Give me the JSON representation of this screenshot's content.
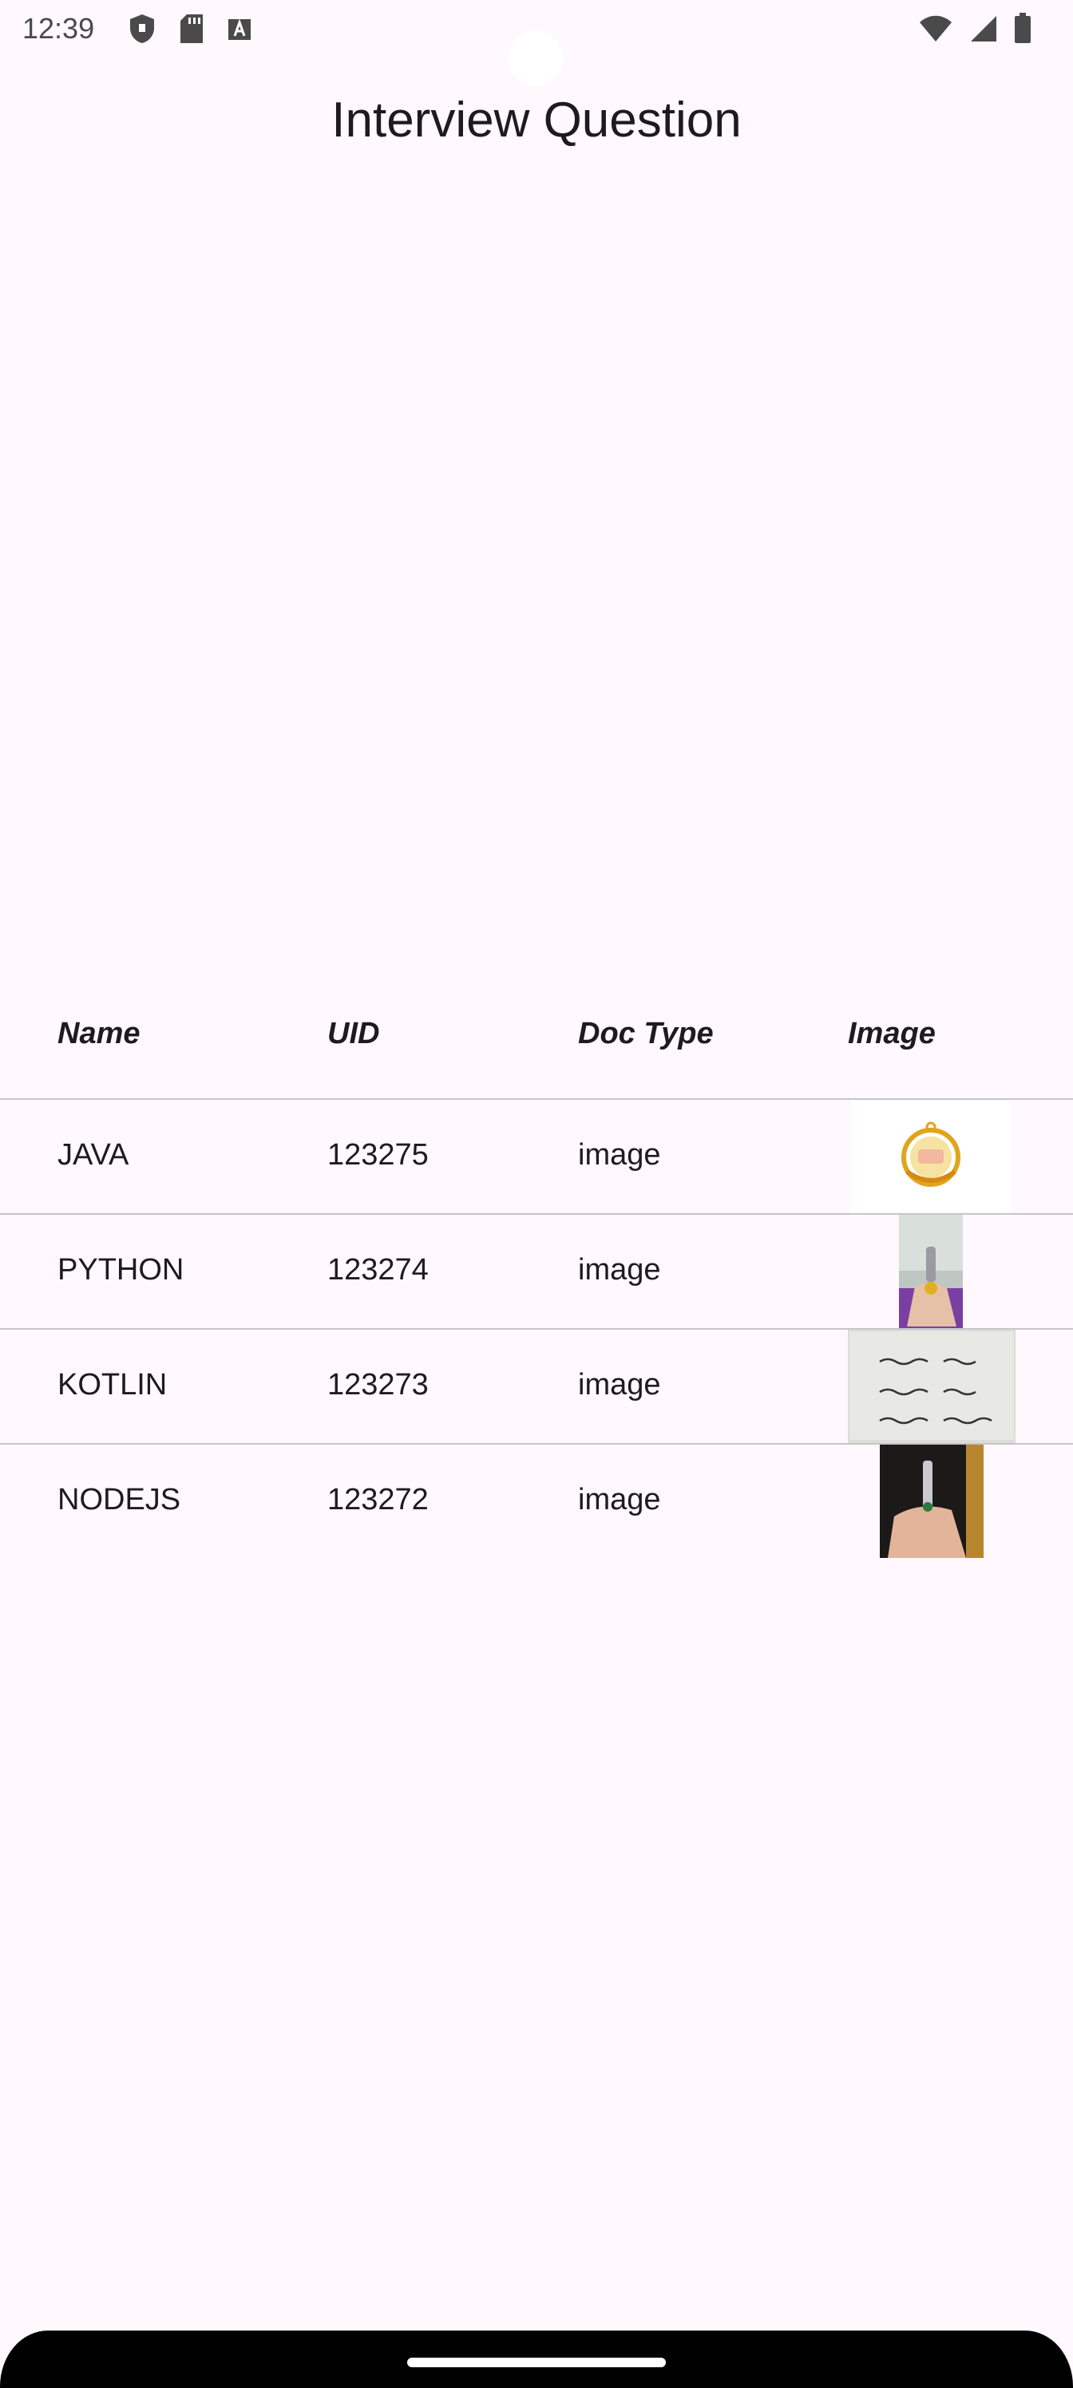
{
  "status_bar": {
    "time": "12:39",
    "left_icons": [
      "shield-icon",
      "sd-card-icon",
      "keyboard-a-icon"
    ],
    "right_icons": [
      "wifi-icon",
      "signal-icon",
      "battery-icon"
    ]
  },
  "page": {
    "title": "Interview Question"
  },
  "table": {
    "headers": {
      "name": "Name",
      "uid": "UID",
      "doc_type": "Doc Type",
      "image": "Image"
    },
    "rows": [
      {
        "name": "JAVA",
        "uid": "123275",
        "doc_type": "image",
        "image_icon": "gold-pendant-thumbnail"
      },
      {
        "name": "PYTHON",
        "uid": "123274",
        "doc_type": "image",
        "image_icon": "hand-pendant-thumbnail"
      },
      {
        "name": "KOTLIN",
        "uid": "123273",
        "doc_type": "image",
        "image_icon": "handwritten-note-thumbnail"
      },
      {
        "name": "NODEJS",
        "uid": "123272",
        "doc_type": "image",
        "image_icon": "hand-pendant-thumbnail"
      }
    ]
  },
  "colors": {
    "background": "#fff8fd",
    "text": "#1d1b20",
    "divider": "#c7c5cb"
  }
}
